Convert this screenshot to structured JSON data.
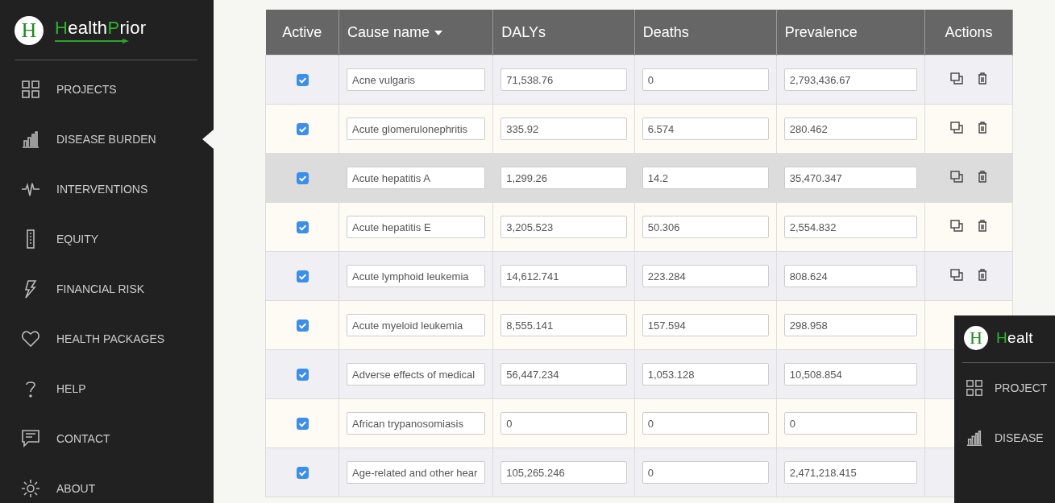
{
  "sidebar": {
    "logo_letter": "H",
    "brand": [
      {
        "text": "H",
        "accent": true
      },
      {
        "text": "ealth",
        "accent": false
      },
      {
        "text": "P",
        "accent": true
      },
      {
        "text": "rior",
        "accent": false
      }
    ],
    "items": [
      {
        "label": "PROJECTS",
        "selected": false
      },
      {
        "label": "DISEASE BURDEN",
        "selected": true
      },
      {
        "label": "INTERVENTIONS",
        "selected": false
      },
      {
        "label": "EQUITY",
        "selected": false
      },
      {
        "label": "FINANCIAL RISK",
        "selected": false
      },
      {
        "label": "HEALTH PACKAGES",
        "selected": false
      },
      {
        "label": "HELP",
        "selected": false
      },
      {
        "label": "CONTACT",
        "selected": false
      },
      {
        "label": "ABOUT",
        "selected": false
      }
    ]
  },
  "table": {
    "columns": [
      {
        "label": "Active",
        "sortable": false
      },
      {
        "label": "Cause name",
        "sortable": true
      },
      {
        "label": "DALYs",
        "sortable": false
      },
      {
        "label": "Deaths",
        "sortable": false
      },
      {
        "label": "Prevalence",
        "sortable": false
      },
      {
        "label": "Actions",
        "sortable": false
      }
    ],
    "rows": [
      {
        "active": true,
        "highlighted": false,
        "cause": "Acne vulgaris",
        "dalys": "71,538.76",
        "deaths": "0",
        "prevalence": "2,793,436.67",
        "actions_shown": true
      },
      {
        "active": true,
        "highlighted": false,
        "cause": "Acute glomerulonephritis",
        "dalys": "335.92",
        "deaths": "6.574",
        "prevalence": "280.462",
        "actions_shown": true
      },
      {
        "active": true,
        "highlighted": true,
        "cause": "Acute hepatitis A",
        "dalys": "1,299.26",
        "deaths": "14.2",
        "prevalence": "35,470.347",
        "actions_shown": true
      },
      {
        "active": true,
        "highlighted": false,
        "cause": "Acute hepatitis E",
        "dalys": "3,205.523",
        "deaths": "50.306",
        "prevalence": "2,554.832",
        "actions_shown": true
      },
      {
        "active": true,
        "highlighted": false,
        "cause": "Acute lymphoid leukemia",
        "dalys": "14,612.741",
        "deaths": "223.284",
        "prevalence": "808.624",
        "actions_shown": true
      },
      {
        "active": true,
        "highlighted": false,
        "cause": "Acute myeloid leukemia",
        "dalys": "8,555.141",
        "deaths": "157.594",
        "prevalence": "298.958",
        "actions_shown": false
      },
      {
        "active": true,
        "highlighted": false,
        "cause": "Adverse effects of medical",
        "dalys": "56,447.234",
        "deaths": "1,053.128",
        "prevalence": "10,508.854",
        "actions_shown": false
      },
      {
        "active": true,
        "highlighted": false,
        "cause": "African trypanosomiasis",
        "dalys": "0",
        "deaths": "0",
        "prevalence": "0",
        "actions_shown": false
      },
      {
        "active": true,
        "highlighted": false,
        "cause": "Age-related and other hear",
        "dalys": "105,265.246",
        "deaths": "0",
        "prevalence": "2,471,218.415",
        "actions_shown": false
      }
    ]
  },
  "overlay_thumbnail": {
    "logo_letter": "H",
    "brand": [
      {
        "text": "H",
        "accent": true
      },
      {
        "text": "ealt",
        "accent": false
      }
    ],
    "items": [
      {
        "label": "PROJECT"
      },
      {
        "label": "DISEASE"
      }
    ]
  }
}
